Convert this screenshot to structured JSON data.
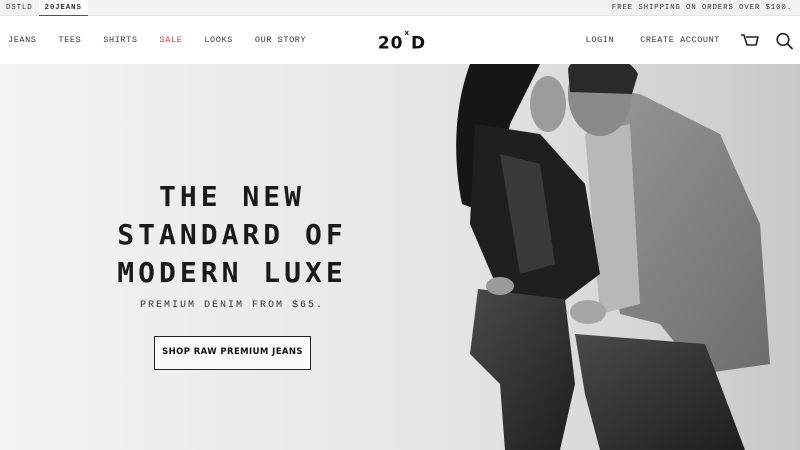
{
  "topbar": {
    "sites": [
      {
        "label": "DSTLD",
        "active": false
      },
      {
        "label": "20JEANS",
        "active": true
      }
    ],
    "promo": "FREE SHIPPING ON ORDERS OVER $100."
  },
  "nav": {
    "left_items": [
      "JEANS",
      "TEES",
      "SHIRTS",
      "SALE",
      "LOOKS",
      "OUR STORY"
    ],
    "logo_main": "20",
    "logo_sup": "x",
    "logo_end": "D",
    "right_items": [
      "LOGIN",
      "CREATE ACCOUNT"
    ],
    "icons": [
      "cart-icon",
      "search-icon"
    ],
    "sale_color": "#d23a3a"
  },
  "hero": {
    "headline": [
      "THE NEW",
      "STANDARD OF",
      "MODERN LUXE"
    ],
    "subline": "PREMIUM DENIM FROM $65.",
    "cta": "SHOP RAW PREMIUM JEANS"
  }
}
